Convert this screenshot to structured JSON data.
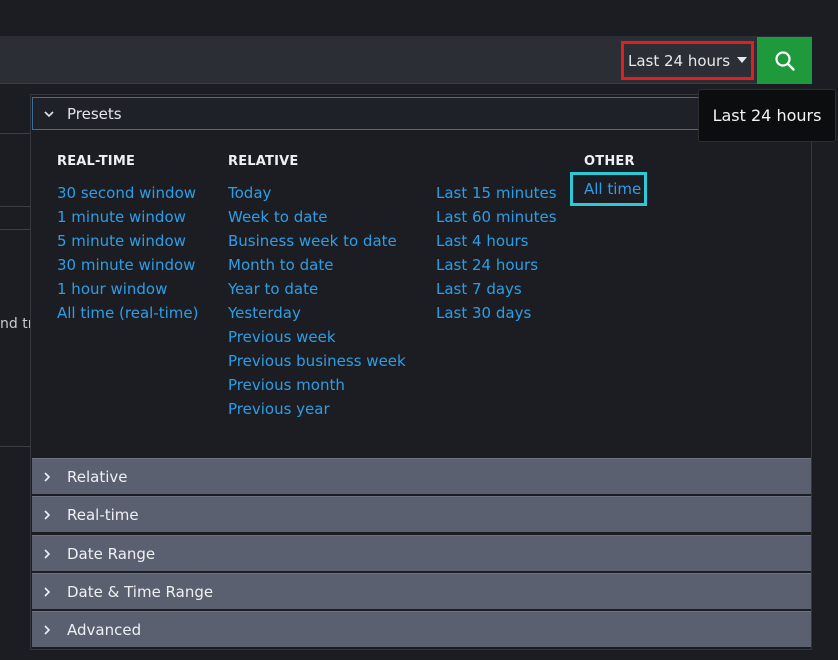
{
  "time_picker": {
    "label": "Last 24 hours"
  },
  "tooltip": {
    "text": "Last 24 hours"
  },
  "background": {
    "fragment": "nd tr"
  },
  "presets": {
    "title": "Presets",
    "columns": {
      "real_time": {
        "heading": "REAL-TIME",
        "items": [
          "30 second window",
          "1 minute window",
          "5 minute window",
          "30 minute window",
          "1 hour window",
          "All time (real-time)"
        ]
      },
      "relative": {
        "heading": "RELATIVE",
        "items": [
          "Today",
          "Week to date",
          "Business week to date",
          "Month to date",
          "Year to date",
          "Yesterday",
          "Previous week",
          "Previous business week",
          "Previous month",
          "Previous year"
        ]
      },
      "relative_more": {
        "items": [
          "Last 15 minutes",
          "Last 60 minutes",
          "Last 4 hours",
          "Last 24 hours",
          "Last 7 days",
          "Last 30 days"
        ]
      },
      "other": {
        "heading": "OTHER",
        "items": [
          "All time"
        ]
      }
    }
  },
  "sections": [
    "Relative",
    "Real-time",
    "Date Range",
    "Date & Time Range",
    "Advanced"
  ],
  "colors": {
    "accent_link": "#2d9ee6",
    "search_button": "#1e9a3c",
    "highlight_red": "#e11f1f",
    "highlight_cyan": "#2dc9d6",
    "section_bg": "#5b6070"
  }
}
